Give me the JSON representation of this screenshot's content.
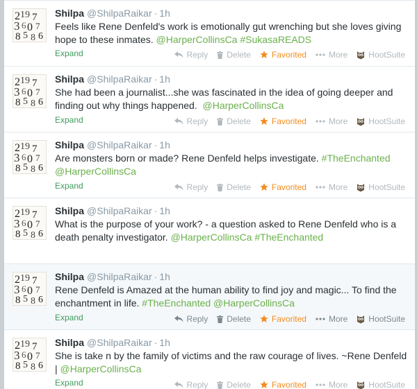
{
  "tweets": [
    {
      "name": "Shilpa",
      "handle": "@ShilpaRaikar",
      "separator": "·",
      "time": "1h",
      "text_plain": "Feels like Rene Denfeld's work is emotionally gut wrenching but she loves giving hope to these inmates.",
      "mentions": "@HarperCollinsCa #SukasaREADS",
      "expand": "Expand",
      "actions": {
        "reply": "Reply",
        "delete": "Delete",
        "favorited": "Favorited",
        "more": "More",
        "hootsuite": "HootSuite"
      }
    },
    {
      "name": "Shilpa",
      "handle": "@ShilpaRaikar",
      "separator": "·",
      "time": "1h",
      "text_plain": "She had been a journalist...she was fascinated in the idea of going deeper and finding out why things happened.",
      "mentions": "@HarperCollinsCa",
      "expand": "Expand",
      "actions": {
        "reply": "Reply",
        "delete": "Delete",
        "favorited": "Favorited",
        "more": "More",
        "hootsuite": "HootSuite"
      }
    },
    {
      "name": "Shilpa",
      "handle": "@ShilpaRaikar",
      "separator": "·",
      "time": "1h",
      "text_plain": "Are monsters born or made? Rene Denfeld helps investigate.",
      "mentions": "#TheEnchanted @HarperCollinsCa",
      "expand": "Expand",
      "actions": {
        "reply": "Reply",
        "delete": "Delete",
        "favorited": "Favorited",
        "more": "More",
        "hootsuite": "HootSuite"
      }
    },
    {
      "name": "Shilpa",
      "handle": "@ShilpaRaikar",
      "separator": "·",
      "time": "1h",
      "text_plain": "What is the purpose of your work? - a question asked to Rene Denfeld who is a death penalty investigator.",
      "mentions": "@HarperCollinsCa #TheEnchanted",
      "expand": "",
      "actions": {}
    },
    {
      "name": "Shilpa",
      "handle": "@ShilpaRaikar",
      "separator": "·",
      "time": "1h",
      "text_plain": "Rene Denfeld is Amazed at the human ability to find joy and magic... To find the enchantment in life.",
      "mentions": "#TheEnchanted @HarperCollinsCa",
      "expand": "Expand",
      "actions": {
        "reply": "Reply",
        "delete": "Delete",
        "favorited": "Favorited",
        "more": "More",
        "hootsuite": "HootSuite"
      }
    },
    {
      "name": "Shilpa",
      "handle": "@ShilpaRaikar",
      "separator": "·",
      "time": "1h",
      "text_plain": "She is take n by the family of victims and the raw courage of lives. ~Rene Denfeld |",
      "mentions": "@HarperCollinsCa",
      "expand": "Expand",
      "actions": {
        "reply": "Reply",
        "delete": "Delete",
        "favorited": "Favorited",
        "more": "More",
        "hootsuite": "HootSuite"
      }
    }
  ],
  "colors": {
    "link": "#6ab04c",
    "favorited": "#f28c1e",
    "expand": "#3d9d5c",
    "muted": "#8899a6"
  }
}
